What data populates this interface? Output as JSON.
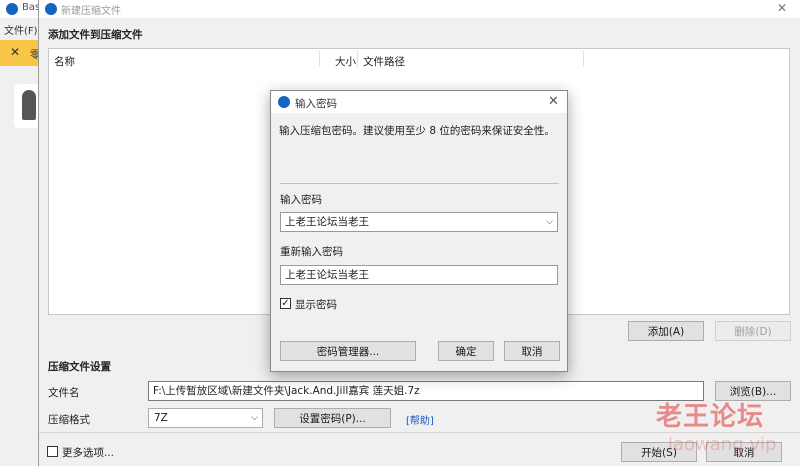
{
  "background_app": {
    "title": "Bas",
    "menu": "文件(F)",
    "warning_text": "零"
  },
  "main": {
    "title": "新建压缩文件",
    "section_add": "添加文件到压缩文件",
    "columns": {
      "name": "名称",
      "size": "大小",
      "path": "文件路径"
    },
    "add_button": "添加(A)",
    "delete_button": "删除(D)",
    "section_settings": "压缩文件设置",
    "filename_label": "文件名",
    "filename_value": "F:\\上传暂放区域\\新建文件夹\\Jack.And.Jill嘉宾 莲天姐.7z",
    "browse_button": "浏览(B)...",
    "format_label": "压缩格式",
    "format_value": "7Z",
    "set_password_button": "设置密码(P)...",
    "help_link": "[帮助]",
    "more_options": "更多选项...",
    "start_button": "开始(S)",
    "cancel_button": "取消"
  },
  "password_dialog": {
    "title": "输入密码",
    "description": "输入压缩包密码。建议使用至少 8 位的密码来保证安全性。",
    "password_label": "输入密码",
    "password_value": "上老王论坛当老王",
    "reenter_label": "重新输入密码",
    "reenter_value": "上老王论坛当老王",
    "show_password_label": "显示密码",
    "show_password_checked": true,
    "manager_button": "密码管理器...",
    "ok_button": "确定",
    "cancel_button": "取消"
  },
  "watermark": {
    "text": "老王论坛",
    "sub": "laowang.vip"
  },
  "colors": {
    "accent": "#1565c0",
    "warning": "#f8c646",
    "desktop": "#2b6cb0",
    "watermark": "#e25555"
  }
}
